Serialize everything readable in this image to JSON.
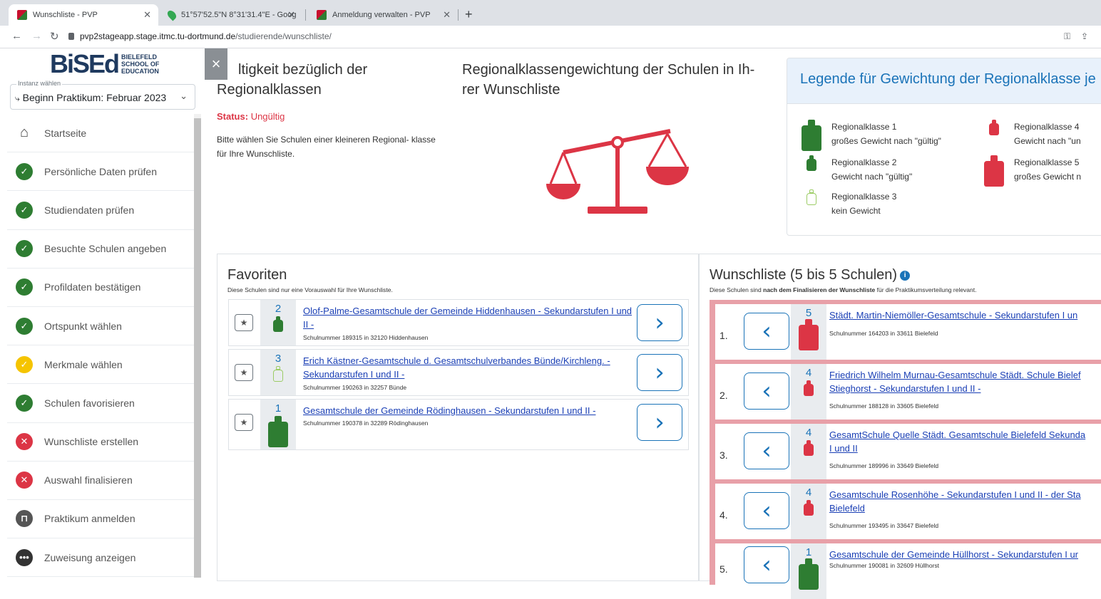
{
  "browser": {
    "tabs": [
      {
        "title": "Wunschliste - PVP",
        "active": true
      },
      {
        "title": "51°57'52.5\"N 8°31'31.4\"E - Goog",
        "active": false
      },
      {
        "title": "Anmeldung verwalten - PVP",
        "active": false
      }
    ],
    "new_tab": "+",
    "url_host": "pvp2stageapp.stage.itmc.tu-dortmund.de",
    "url_path": "/studierende/wunschliste/"
  },
  "sidebar": {
    "logo_text": "BiSEd",
    "logo_sub": [
      "BIELEFELD",
      "SCHOOL OF",
      "EDUCATION"
    ],
    "instanz_label": "Instanz wählen",
    "instanz_value": "Beginn Praktikum: Februar 2023",
    "items": [
      {
        "label": "Startseite",
        "state": "home"
      },
      {
        "label": "Persönliche Daten prüfen",
        "state": "ok"
      },
      {
        "label": "Studiendaten prüfen",
        "state": "ok"
      },
      {
        "label": "Besuchte Schulen angeben",
        "state": "ok"
      },
      {
        "label": "Profildaten bestätigen",
        "state": "ok"
      },
      {
        "label": "Ortspunkt wählen",
        "state": "ok"
      },
      {
        "label": "Merkmale wählen",
        "state": "warn"
      },
      {
        "label": "Schulen favorisieren",
        "state": "ok"
      },
      {
        "label": "Wunschliste erstellen",
        "state": "error"
      },
      {
        "label": "Auswahl finalisieren",
        "state": "error"
      },
      {
        "label": "Praktikum anmelden",
        "state": "locked"
      },
      {
        "label": "Zuweisung anzeigen",
        "state": "more"
      }
    ]
  },
  "close_label": "×",
  "gueltigkeit": {
    "title": "ltigkeit bezüglich der Regionalklassen",
    "status_label": "Status:",
    "status_value": "Ungültig",
    "hint": "Bitte wählen Sie Schulen einer kleineren Regional- klasse für Ihre Wunschliste."
  },
  "gewichtung": {
    "title": "Regionalklassengewichtung der Schulen in Ih- rer Wunschliste"
  },
  "legend": {
    "title": "Legende für Gewichtung der Regionalklasse je",
    "items": [
      {
        "name": "Regionalklasse 1",
        "desc": "großes Gewicht nach \"gültig\"",
        "color": "#2e7d32"
      },
      {
        "name": "Regionalklasse 2",
        "desc": "Gewicht nach \"gültig\"",
        "color": "#2e7d32"
      },
      {
        "name": "Regionalklasse 3",
        "desc": "kein Gewicht",
        "color": "#7ab648"
      },
      {
        "name": "Regionalklasse 4",
        "desc": "Gewicht nach \"un",
        "color": "#dc3545"
      },
      {
        "name": "Regionalklasse 5",
        "desc": "großes Gewicht n",
        "color": "#dc3545"
      }
    ]
  },
  "favoriten": {
    "title": "Favoriten",
    "subtitle": "Diese Schulen sind nur eine Vorauswahl für Ihre Wunschliste.",
    "rows": [
      {
        "rk": "2",
        "name": "Olof-Palme-Gesamtschule der Gemeinde Hiddenhausen - Sekundarstufen I und II -",
        "meta": "Schulnummer 189315 in 32120 Hiddenhausen"
      },
      {
        "rk": "3",
        "name": "Erich Kästner-Gesamtschule d. Gesamtschulverbandes Bünde/Kirchleng. - Sekundarstufen I und II -",
        "meta": "Schulnummer 190263 in 32257 Bünde"
      },
      {
        "rk": "1",
        "name": "Gesamtschule der Gemeinde Rödinghausen - Sekundarstufen I und II -",
        "meta": "Schulnummer 190378 in 32289 Rödinghausen"
      }
    ]
  },
  "wunschliste": {
    "title": "Wunschliste (5 bis 5 Schulen)",
    "subtitle_pre": "Diese Schulen sind ",
    "subtitle_bold": "nach dem Finalisieren der Wunschliste",
    "subtitle_post": " für die Praktikumsverteilung relevant.",
    "rows": [
      {
        "pos": "1.",
        "rk": "5",
        "name": "Städt. Martin-Niemöller-Gesamtschule - Sekundarstufen I un",
        "name2": "",
        "meta": "Schulnummer 164203 in 33611 Bielefeld"
      },
      {
        "pos": "2.",
        "rk": "4",
        "name": "Friedrich Wilhelm Murnau-Gesamtschule Städt. Schule Bielef",
        "name2": "Stieghorst - Sekundarstufen I und II -",
        "meta": "Schulnummer 188128 in 33605 Bielefeld"
      },
      {
        "pos": "3.",
        "rk": "4",
        "name": "GesamtSchule Quelle Städt. Gesamtschule Bielefeld Sekunda",
        "name2": "I und II",
        "meta": "Schulnummer 189996 in 33649 Bielefeld"
      },
      {
        "pos": "4.",
        "rk": "4",
        "name": "Gesamtschule Rosenhöhe - Sekundarstufen I und II - der Sta",
        "name2": "Bielefeld",
        "meta": "Schulnummer 193495 in 33647 Bielefeld"
      },
      {
        "pos": "5.",
        "rk": "1",
        "name": "Gesamtschule der Gemeinde Hüllhorst - Sekundarstufen I ur",
        "name2": "",
        "meta": "Schulnummer 190081 in 32609 Hüllhorst"
      }
    ]
  }
}
